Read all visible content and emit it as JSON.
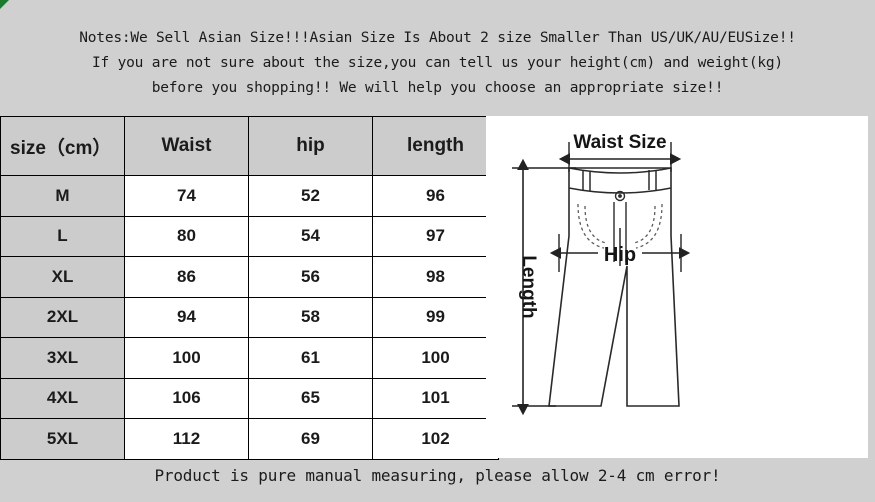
{
  "notes": {
    "lines": [
      "Notes:We Sell Asian Size!!!Asian Size Is About 2 size Smaller Than US/UK/AU/EUSize!!",
      "If you are not sure about the size,you can tell us your height(cm) and weight(kg)",
      "before you shopping!! We will help you choose an appropriate size!!"
    ]
  },
  "table": {
    "headers": {
      "size": "size（cm）",
      "waist": "Waist",
      "hip": "hip",
      "length": "length"
    },
    "rows": [
      {
        "size": "M",
        "waist": "74",
        "hip": "52",
        "length": "96"
      },
      {
        "size": "L",
        "waist": "80",
        "hip": "54",
        "length": "97"
      },
      {
        "size": "XL",
        "waist": "86",
        "hip": "56",
        "length": "98"
      },
      {
        "size": "2XL",
        "waist": "94",
        "hip": "58",
        "length": "99"
      },
      {
        "size": "3XL",
        "waist": "100",
        "hip": "61",
        "length": "100"
      },
      {
        "size": "4XL",
        "waist": "106",
        "hip": "65",
        "length": "101"
      },
      {
        "size": "5XL",
        "waist": "112",
        "hip": "69",
        "length": "102"
      }
    ]
  },
  "diagram": {
    "waist_label": "Waist Size",
    "hip_label": "Hip",
    "length_label": "Length"
  },
  "footer": {
    "text": "Product is pure manual measuring, please allow 2-4 cm error!"
  },
  "colors": {
    "background": "#d0d0d0",
    "header_cell": "#cccccc",
    "data_cell": "#ffffff",
    "border": "#000000",
    "text": "#1b1b1b",
    "corner_mark": "#1a7a2e"
  }
}
